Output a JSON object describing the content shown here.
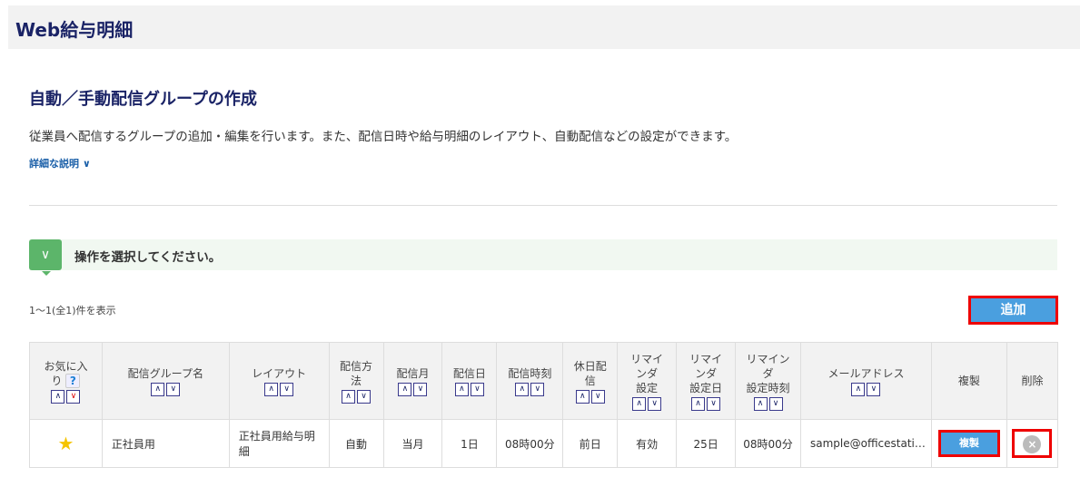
{
  "app": {
    "title": "Web給与明細"
  },
  "page": {
    "title": "自動／手動配信グループの作成",
    "description": "従業員へ配信するグループの追加・編集を行います。また、配信日時や給与明細のレイアウト、自動配信などの設定ができます。",
    "more_link": "詳細な説明 ∨"
  },
  "operation": {
    "prompt": "操作を選択してください。"
  },
  "list": {
    "count": "1〜1(全1)件を表示",
    "add_label": "追加"
  },
  "table": {
    "headers": {
      "fav1": "お気に入",
      "fav2": "り",
      "group": "配信グループ名",
      "layout": "レイアウト",
      "method1": "配信方",
      "method2": "法",
      "month": "配信月",
      "day": "配信日",
      "time": "配信時刻",
      "holiday1": "休日配",
      "holiday2": "信",
      "rem1": "リマイ",
      "rem2": "ンダ",
      "rem3": "設定",
      "remday1": "リマイ",
      "remday2": "ンダ",
      "remday3": "設定日",
      "remtime1": "リマイン",
      "remtime2": "ダ",
      "remtime3": "設定時刻",
      "email": "メールアドレス",
      "copy": "複製",
      "delete": "削除"
    },
    "rows": [
      {
        "group": "正社員用",
        "layout1": "正社員用給与明",
        "layout2": "細",
        "method": "自動",
        "month": "当月",
        "day": "1日",
        "time": "08時00分",
        "holiday": "前日",
        "reminder": "有効",
        "reminder_day": "25日",
        "reminder_time": "08時00分",
        "email": "sample@officestati…",
        "copy_label": "複製"
      }
    ]
  }
}
